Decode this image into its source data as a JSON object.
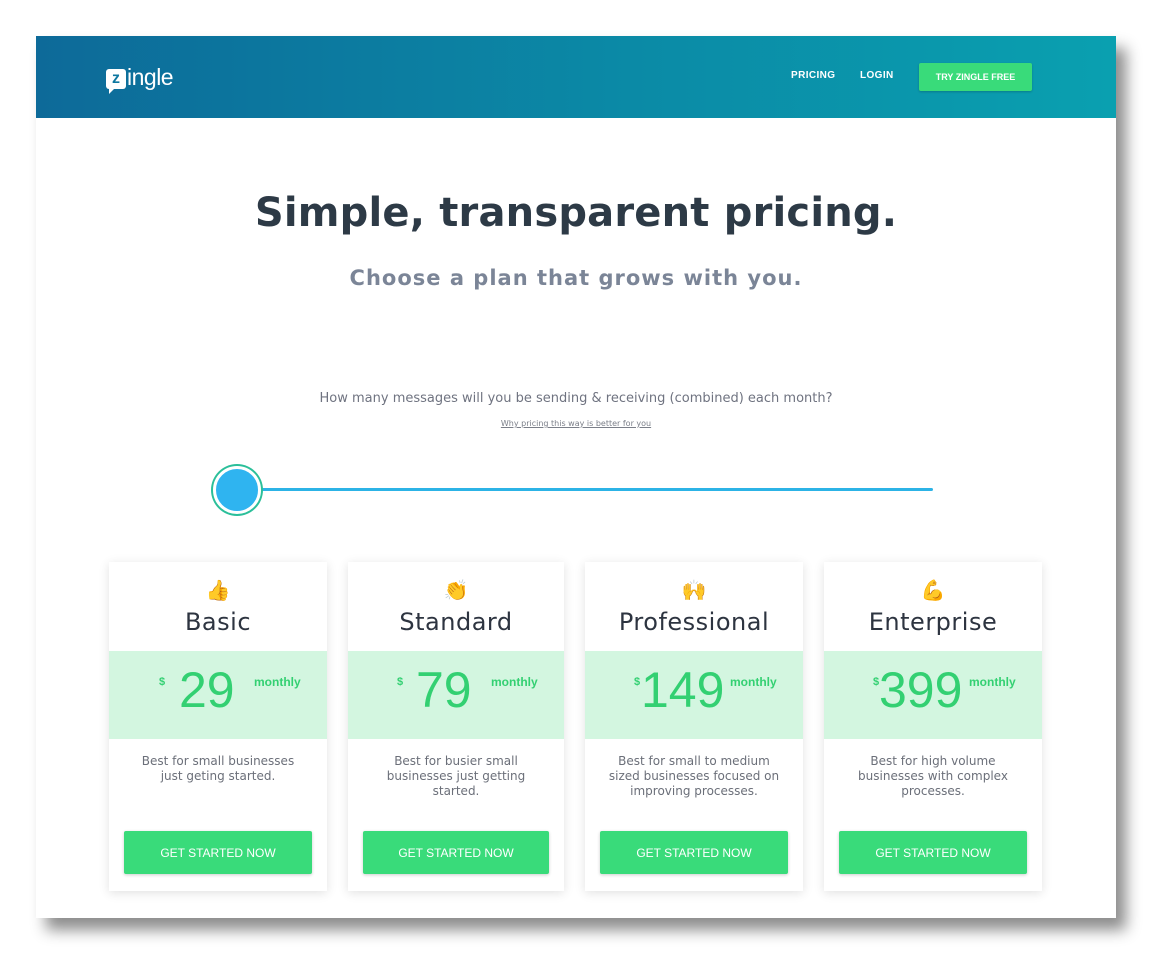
{
  "header": {
    "logo_mark": "z",
    "logo_text": "ingle",
    "nav": {
      "pricing_label": "PRICING",
      "login_label": "LOGIN",
      "cta_label": "TRY ZINGLE FREE"
    }
  },
  "hero": {
    "title": "Simple, transparent pricing.",
    "subtitle": "Choose a plan that grows with you."
  },
  "volume": {
    "question": "How many messages will you be sending & receiving (combined) each month?",
    "why_link": "Why pricing this way is better for you",
    "slider_level": 0
  },
  "plans": [
    {
      "emoji": "👍",
      "icon": "thumbs-up-icon",
      "name": "Basic",
      "currency": "$",
      "price": "29",
      "period": "monthly",
      "description": "Best for small businesses just geting started.",
      "button": "GET STARTED NOW"
    },
    {
      "emoji": "👏",
      "icon": "clapping-hands-icon",
      "name": "Standard",
      "currency": "$",
      "price": "79",
      "period": "monthly",
      "description": "Best for busier small businesses just getting started.",
      "button": "GET STARTED NOW"
    },
    {
      "emoji": "🙌",
      "icon": "raised-hands-icon",
      "name": "Professional",
      "currency": "$",
      "price": "149",
      "period": "monthly",
      "description": "Best for small to medium sized businesses focused on improving processes.",
      "button": "GET STARTED NOW"
    },
    {
      "emoji": "💪",
      "icon": "flexed-biceps-icon",
      "name": "Enterprise",
      "currency": "$",
      "price": "399",
      "period": "monthly",
      "description": "Best for high volume businesses with complex processes.",
      "button": "GET STARTED NOW"
    }
  ],
  "colors": {
    "header_start": "#0d6a99",
    "header_end": "#0aa0b0",
    "accent_green": "#39db7a",
    "price_band": "#d3f6e0",
    "slider_blue": "#2fb4f0"
  }
}
